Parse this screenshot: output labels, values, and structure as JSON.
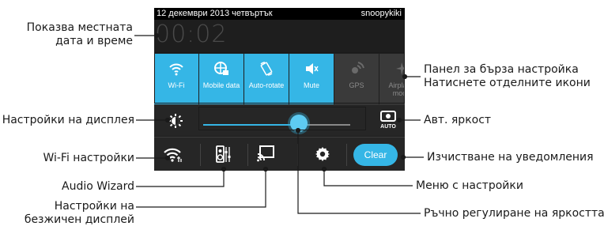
{
  "status_bar": {
    "date": "12 декември 2013 четвъртък",
    "user": "snoopykiki"
  },
  "clock": "00:02",
  "quick_tiles": [
    {
      "label": "Wi-Fi",
      "icon": "wifi-icon",
      "state": "on"
    },
    {
      "label": "Mobile data",
      "icon": "mobile-data-icon",
      "state": "on"
    },
    {
      "label": "Auto-rotate",
      "icon": "auto-rotate-icon",
      "state": "on"
    },
    {
      "label": "Mute",
      "icon": "mute-icon",
      "state": "on"
    },
    {
      "label": "GPS",
      "icon": "gps-icon",
      "state": "off"
    },
    {
      "label": "Airplane mode",
      "icon": "airplane-icon",
      "state": "off"
    }
  ],
  "brightness": {
    "level": 0.65,
    "auto_label": "AUTO"
  },
  "buttons": {
    "clear": "Clear"
  },
  "callouts": {
    "date_time_1": "Показва местната",
    "date_time_2": "дата и време",
    "quick_panel_1": "Панел за бърза настройка",
    "quick_panel_2": "Натиснете отделните икони",
    "display_settings": "Настройки на дисплея",
    "auto_brightness": "Авт. яркост",
    "wifi_settings": "Wi-Fi настройки",
    "clear_notifications": "Изчистване на уведомления",
    "audio_wizard": "Audio Wizard",
    "settings_menu": "Меню с настройки",
    "wireless_display_1": "Настройки на",
    "wireless_display_2": "безжичен дисплей",
    "manual_brightness": "Ръчно регулиране на яркостта"
  },
  "colors": {
    "accent": "#35b6e6",
    "panel": "#1e1e1e"
  }
}
